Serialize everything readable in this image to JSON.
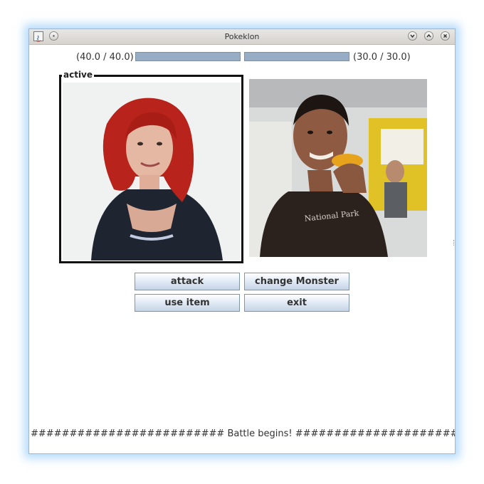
{
  "window": {
    "title": "Pokeklon"
  },
  "titlebar": {
    "icons": [
      "java-app-icon",
      "menu-circle-icon",
      "minimize-icon",
      "maximize-icon",
      "close-icon"
    ]
  },
  "battle": {
    "player_hp_text": "(40.0 / 40.0)",
    "player_hp_fraction": 1.0,
    "enemy_hp_text": "(30.0 / 30.0)",
    "enemy_hp_fraction": 1.0,
    "active_label": "active"
  },
  "actions": {
    "attack_label": "attack",
    "change_label": "change Monster",
    "item_label": "use item",
    "exit_label": "exit"
  },
  "log": {
    "text": "######################### Battle begins! #########################"
  },
  "colors": {
    "hp_fill": "#97adc6",
    "window_glow": "#78bef5",
    "active_border": "#111111"
  }
}
